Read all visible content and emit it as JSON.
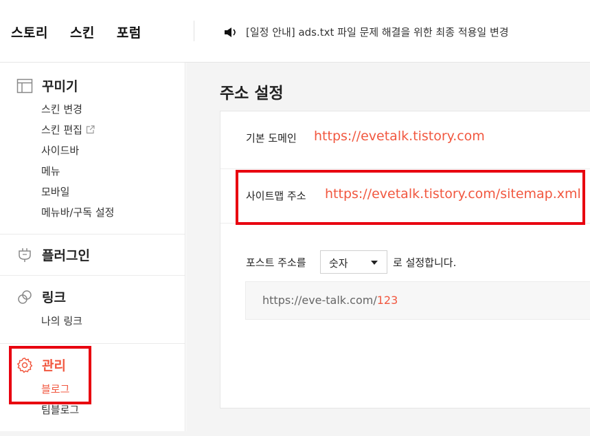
{
  "topbar": {
    "nav": [
      "스토리",
      "스킨",
      "포럼"
    ],
    "notice": "[일정 안내] ads.txt 파일 문제 해결을 위한 최종 적용일 변경"
  },
  "sidebar": {
    "decorate": {
      "title": "꾸미기",
      "items": [
        "스킨 변경",
        "스킨 편집",
        "사이드바",
        "메뉴",
        "모바일",
        "메뉴바/구독 설정"
      ]
    },
    "plugin": {
      "title": "플러그인"
    },
    "link": {
      "title": "링크",
      "items": [
        "나의 링크"
      ]
    },
    "manage": {
      "title": "관리",
      "items": [
        "블로그",
        "팀블로그"
      ]
    }
  },
  "main": {
    "title": "주소 설정",
    "domain_label": "기본 도메인",
    "domain_value": "https://evetalk.tistory.com",
    "sitemap_label": "사이트맵 주소",
    "sitemap_value": "https://evetalk.tistory.com/sitemap.xml",
    "post_label_before": "포스트 주소를",
    "post_select": "숫자",
    "post_label_after": "로 설정합니다.",
    "preview_base": "https://eve-talk.com/",
    "preview_num": "123"
  },
  "colors": {
    "accent": "#f1573f",
    "highlight_box": "#e8000f"
  }
}
